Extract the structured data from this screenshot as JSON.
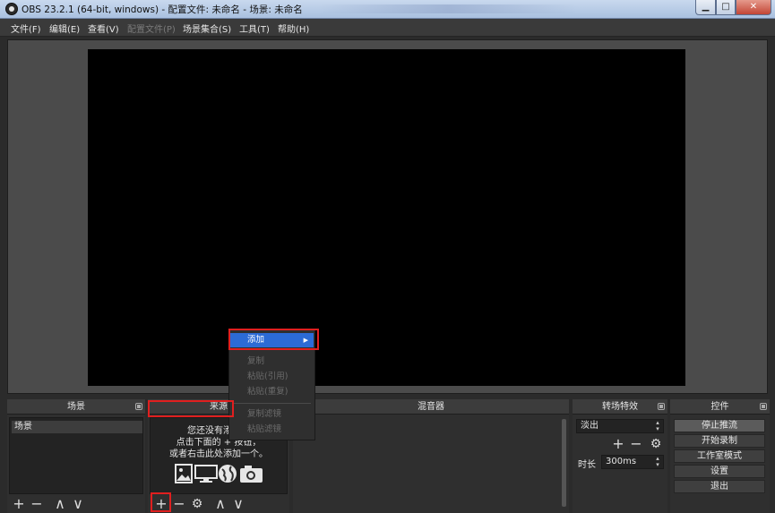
{
  "window": {
    "title": "OBS 23.2.1 (64-bit, windows) - 配置文件: 未命名 - 场景: 未命名",
    "min_glyph": "▁",
    "max_glyph": "□",
    "close_glyph": "✕"
  },
  "menubar": {
    "items": [
      "文件(F)",
      "编辑(E)",
      "查看(V)",
      "配置文件(P)",
      "场景集合(S)",
      "工具(T)",
      "帮助(H)"
    ],
    "disabled": [
      "配置文件(P)"
    ]
  },
  "docks": {
    "scenes": {
      "title": "场景",
      "items": [
        "场景"
      ]
    },
    "sources": {
      "title": "来源",
      "empty_lines": [
        "您还没有添加任",
        "点击下面的 + 按钮，",
        "或者右击此处添加一个。"
      ],
      "empty_icons": [
        "image-icon",
        "display-icon",
        "globe-icon",
        "camera-icon"
      ]
    },
    "mixer": {
      "title": "混音器"
    },
    "transitions": {
      "title": "转场特效",
      "selected": "淡出",
      "duration_label": "时长",
      "duration_value": "300ms"
    },
    "controls": {
      "title": "控件",
      "buttons": [
        "停止推流",
        "开始录制",
        "工作室模式",
        "设置",
        "退出"
      ]
    }
  },
  "context_menu": {
    "items": [
      {
        "label": "添加",
        "enabled": true,
        "submenu": true
      },
      {
        "label": "复制",
        "enabled": false
      },
      {
        "label": "粘贴(引用)",
        "enabled": false
      },
      {
        "label": "粘贴(重复)",
        "enabled": false
      },
      {
        "label": "复制滤镜",
        "enabled": false
      },
      {
        "label": "粘贴滤镜",
        "enabled": false
      }
    ],
    "submenu_arrow": "▶"
  },
  "toolbar_glyphs": {
    "add": "+",
    "remove": "−",
    "up": "∧",
    "down": "∨",
    "gear": "⚙"
  },
  "colors": {
    "highlight": "#e01f1f",
    "menu_active": "#2c6bd6"
  }
}
